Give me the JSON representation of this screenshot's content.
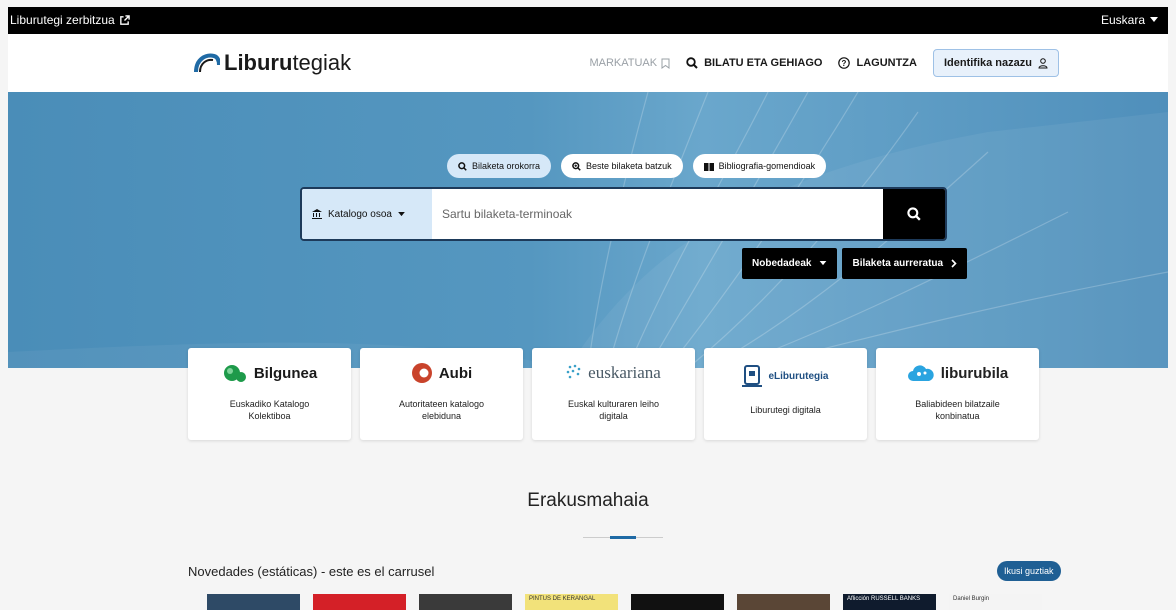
{
  "topbar": {
    "service_label": "Liburutegi zerbitzua",
    "language": "Euskara"
  },
  "header": {
    "logo_bold": "Liburu",
    "logo_light": "tegiak",
    "nav": {
      "marked": "MARKATUAK",
      "search_more": "BILATU ETA GEHIAGO",
      "help": "LAGUNTZA",
      "login": "Identifika nazazu"
    }
  },
  "hero": {
    "pills": [
      "Bilaketa orokorra",
      "Beste bilaketa batzuk",
      "Bibliografia-gomendioak"
    ],
    "catalog_selector": "Katalogo osoa",
    "search_placeholder": "Sartu bilaketa-terminoak",
    "buttons": {
      "news": "Nobedadeak",
      "advanced": "Bilaketa aurreratua"
    }
  },
  "cards": [
    {
      "brand": "Bilgunea",
      "desc": "Euskadiko Katalogo Kolektiboa"
    },
    {
      "brand": "Aubi",
      "desc": "Autoritateen katalogo elebiduna"
    },
    {
      "brand": "euskariana",
      "desc": "Euskal kulturaren leiho digitala"
    },
    {
      "brand": "eLiburutegia",
      "desc": "Liburutegi digitala"
    },
    {
      "brand": "liburubila",
      "desc": "Baliabideen bilatzaile konbinatua"
    }
  ],
  "showcase": {
    "title": "Erakusmahaia",
    "carousel_title": "Novedades (estáticas) - este es el carrusel",
    "see_all": "Ikusi guztiak",
    "books": [
      {
        "label": "",
        "color": "#2e4a66"
      },
      {
        "label": "",
        "color": "#d42027"
      },
      {
        "label": "",
        "color": "#3a3a3a"
      },
      {
        "label": "PINTUS DE KERANGAL",
        "color": "#f2e27a"
      },
      {
        "label": "",
        "color": "#111111"
      },
      {
        "label": "",
        "color": "#5a4636"
      },
      {
        "label": "Aflicción RUSSELL BANKS",
        "color": "#0f1b2d"
      },
      {
        "label": "Daniel Burgin",
        "color": "#f4f4f4"
      }
    ]
  },
  "colors": {
    "accent": "#1f6aa5",
    "hero_blue": "#5597c0",
    "active_pill": "#d6e8f8"
  }
}
